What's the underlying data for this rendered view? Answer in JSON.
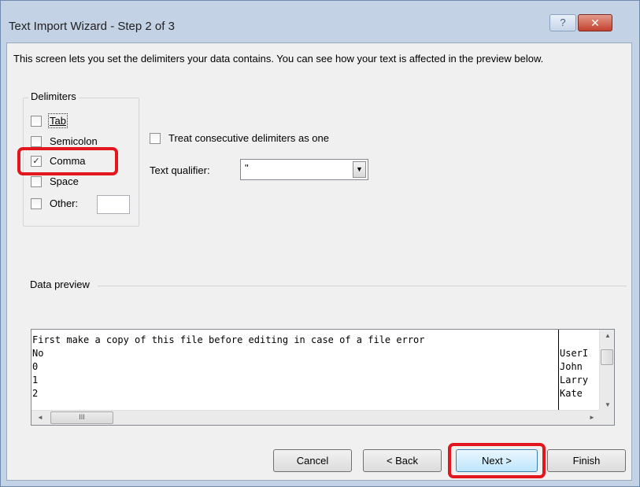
{
  "window": {
    "title": "Text Import Wizard - Step 2 of 3",
    "help_glyph": "?",
    "close_glyph": "✕"
  },
  "description": "This screen lets you set the delimiters your data contains.  You can see how your text is affected in the preview below.",
  "delimiters": {
    "title": "Delimiters",
    "items": [
      {
        "label": "Tab",
        "checked": false
      },
      {
        "label": "Semicolon",
        "checked": false
      },
      {
        "label": "Comma",
        "checked": true
      },
      {
        "label": "Space",
        "checked": false
      },
      {
        "label": "Other:",
        "checked": false
      }
    ],
    "other_value": ""
  },
  "options": {
    "consecutive_label": "Treat consecutive delimiters as one",
    "consecutive_checked": false,
    "qualifier_label": "Text qualifier:",
    "qualifier_value": "\""
  },
  "preview": {
    "title": "Data preview",
    "lines": [
      "First make a copy of this file before editing in case of a file error",
      "No",
      "0",
      "1",
      "2"
    ],
    "col2": [
      "",
      "UserI",
      "John",
      "Larry",
      "Kate"
    ],
    "hthumb_glyph": "III"
  },
  "buttons": {
    "cancel": "Cancel",
    "back": "< Back",
    "next": "Next >",
    "finish": "Finish"
  },
  "colors": {
    "highlight": "#e3151d",
    "dialog_bg": "#f0f0f0",
    "frame": "#c3d2e4"
  }
}
